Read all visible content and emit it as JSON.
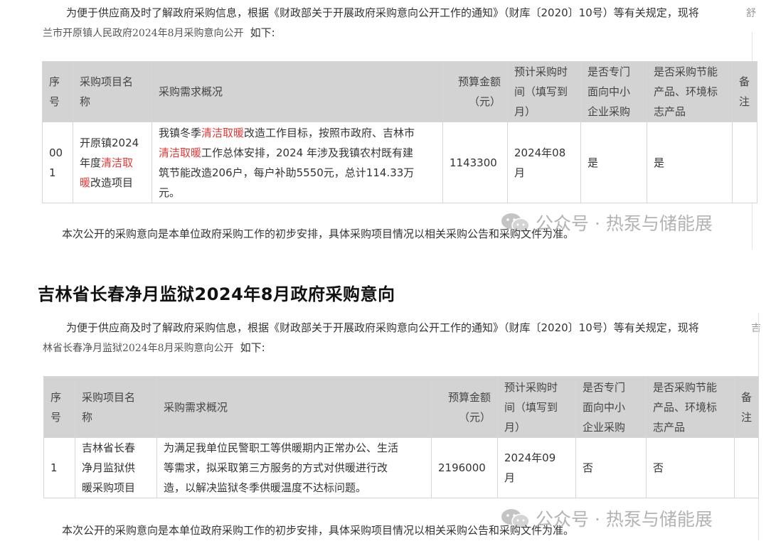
{
  "section1": {
    "intro_line1": "为便于供应商及时了解政府采购信息，根据《财政部关于开展政府采购意向公开工作的通知》（财库〔2020〕10号）等有关规定，现将",
    "side_char": "舒",
    "intro_line2_name": "兰市开原镇人民政府2024年8月采购意向公开",
    "intro_line2_suffix": "如下:",
    "headers": {
      "seq": [
        "序",
        "号"
      ],
      "name": [
        "采购项目名",
        "称"
      ],
      "desc": "采购需求概况",
      "budget": [
        "预算金额",
        "（元）"
      ],
      "time": [
        "预计采购时",
        "间（填写到",
        "月）"
      ],
      "sme": [
        "是否专门",
        "面向中小",
        "企业采购"
      ],
      "energy": [
        "是否采购节能",
        "产品、环境标",
        "志产品"
      ],
      "remark": [
        "备",
        "注"
      ]
    },
    "row": {
      "seq": [
        "00",
        "1"
      ],
      "name_a": "开原镇2024",
      "name_b": "年度",
      "name_hl_1": "清洁取",
      "name_hl_2": "暖",
      "name_c": "改造项目",
      "desc_a": "我镇冬季",
      "desc_hl_1": "清洁取暖",
      "desc_b": "改造工作目标，按照市政府、吉林市",
      "desc_hl_2": "清洁取暖",
      "desc_c": "工作总体安排，2024 年涉及我镇农村既有建",
      "desc_d": "筑节能改造206户，每户补助5550元，总计114.33万",
      "desc_e": "元。",
      "budget": "1143300",
      "time": [
        "2024年08",
        "月"
      ],
      "sme": "是",
      "energy": "是",
      "remark": ""
    },
    "note": "本次公开的采购意向是本单位政府采购工作的初步安排，具体采购项目情况以相关采购公告和采购文件为准。"
  },
  "section2": {
    "heading": "吉林省长春净月监狱2024年8月政府采购意向",
    "intro_line1": "为便于供应商及时了解政府采购信息，根据《财政部关于开展政府采购意向公开工作的通知》（财库〔2020〕10号）等有关规定，现将",
    "side_char": "吉",
    "intro_line2_name": "林省长春净月监狱2024年8月采购意向公开",
    "intro_line2_suffix": "如下:",
    "headers": {
      "seq": [
        "序",
        "号"
      ],
      "name": [
        "采购项目名",
        "称"
      ],
      "desc": "采购需求概况",
      "budget": [
        "预算金额",
        "（元）"
      ],
      "time": [
        "预计采购时",
        "间（填写到",
        "月）"
      ],
      "sme": [
        "是否专门",
        "面向中小",
        "企业采购"
      ],
      "energy": [
        "是否采购节能",
        "产品、环境标",
        "志产品"
      ],
      "remark": [
        "备",
        "注"
      ]
    },
    "row": {
      "seq": "1",
      "name": [
        "吉林省长春",
        "净月监狱供",
        "暖采购项目"
      ],
      "desc": [
        "为满足我单位民警职工等供暖期内正常办公、生活",
        "等需求，拟采取第三方服务的方式对供暖进行改",
        "造，以解决监狱冬季供暖温度不达标问题。"
      ],
      "budget": "2196000",
      "time": [
        "2024年09",
        "月"
      ],
      "sme": "否",
      "energy": "否",
      "remark": ""
    },
    "note": "本次公开的采购意向是本单位政府采购工作的初步安排，具体采购项目情况以相关采购公告和采购文件为准。"
  },
  "watermark": {
    "text": "公众号 · 热泵与储能展",
    "icon": "wechat-icon"
  },
  "colors": {
    "highlight": "#e53935",
    "header_bg": "#d3d3d3",
    "watermark": "#b3b3b3"
  }
}
